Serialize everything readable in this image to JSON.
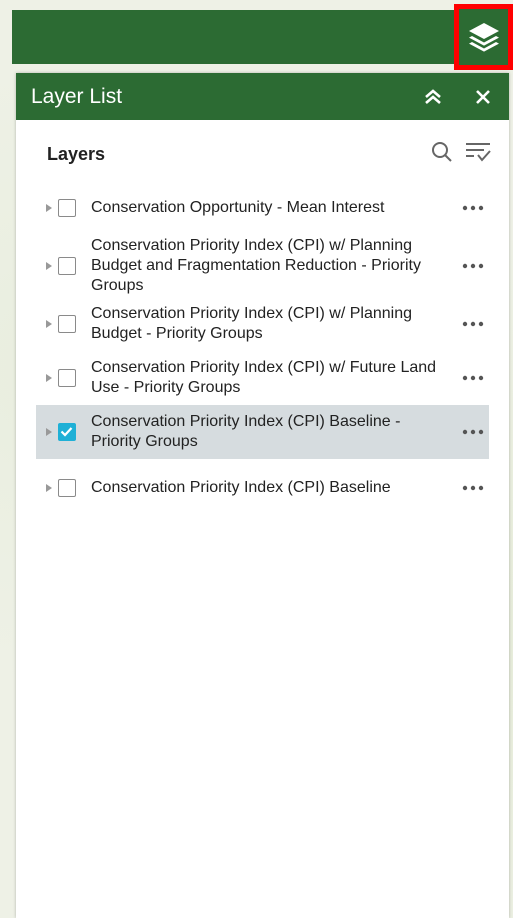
{
  "panel": {
    "title": "Layer List",
    "collapse_icon": "double-chevron-up-icon",
    "close_icon": "close-icon"
  },
  "toolbar": {
    "heading": "Layers",
    "search_icon": "search-icon",
    "filter_icon": "filter-icon"
  },
  "layers": [
    {
      "label": "Conservation Opportunity - Mean Interest",
      "checked": false
    },
    {
      "label": "Conservation Priority Index (CPI) w/ Planning Budget and Fragmentation Reduction - Priority Groups",
      "checked": false
    },
    {
      "label": "Conservation Priority Index (CPI) w/ Planning Budget - Priority Groups",
      "checked": false
    },
    {
      "label": "Conservation Priority Index (CPI) w/ Future Land Use - Priority Groups",
      "checked": false
    },
    {
      "label": "Conservation Priority Index (CPI) Baseline - Priority Groups",
      "checked": true
    },
    {
      "label": "Conservation Priority Index (CPI) Baseline",
      "checked": false
    }
  ],
  "colors": {
    "header": "#2c6b33",
    "checked": "#1fb0d6",
    "selected_row": "#d6dcdf",
    "highlight": "#ff0000"
  }
}
